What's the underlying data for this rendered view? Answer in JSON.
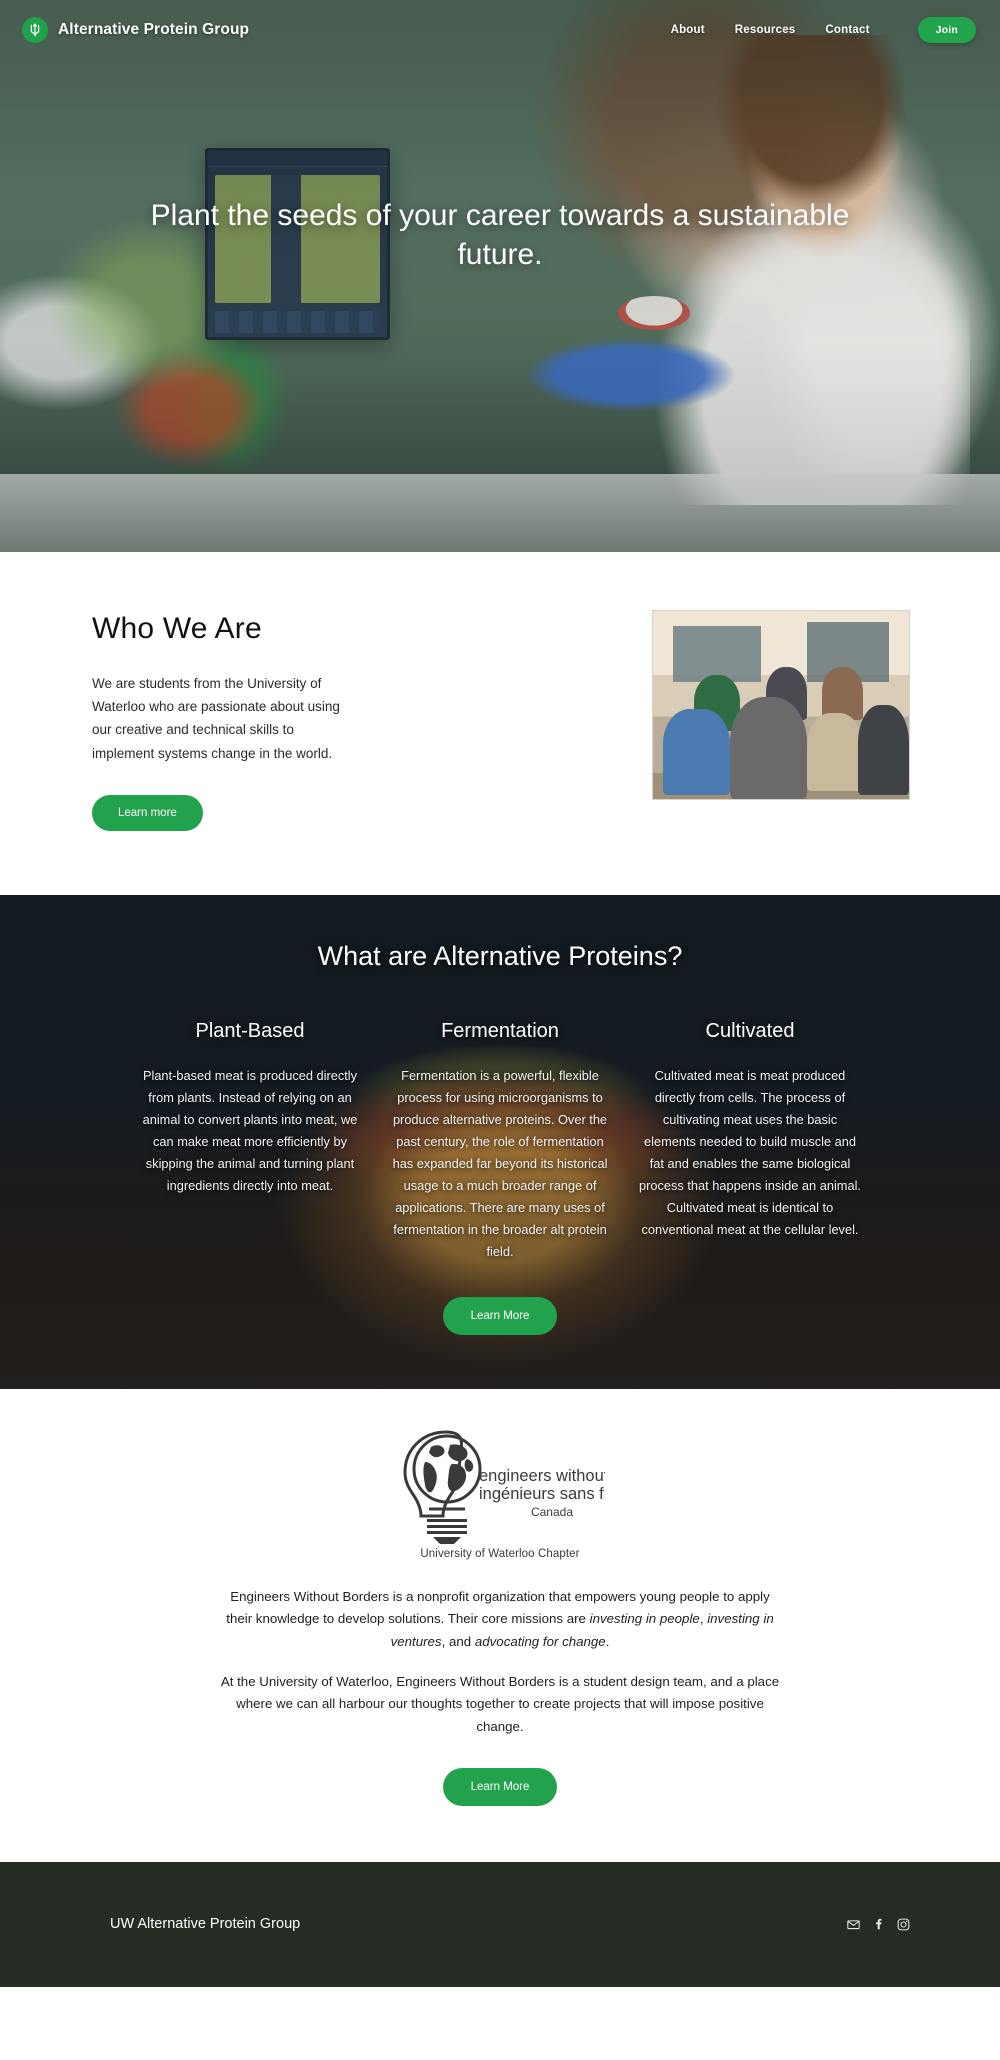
{
  "brand": {
    "name": "Alternative Protein Group",
    "logo_icon": "wheat-w-logo-icon",
    "accent_color": "#21a44c"
  },
  "nav": {
    "links": [
      {
        "label": "About"
      },
      {
        "label": "Resources"
      },
      {
        "label": "Contact"
      }
    ],
    "cta_label": "Join"
  },
  "hero": {
    "headline": "Plant the seeds of your career towards a sustainable future."
  },
  "who_we_are": {
    "title": "Who We Are",
    "body": "We are students from the University of Waterloo who are passionate about using our creative and technical skills to implement systems change in the world.",
    "button_label": "Learn more",
    "photo_alt": "students-meeting-photo"
  },
  "alt_proteins": {
    "title": "What are Alternative Proteins?",
    "columns": [
      {
        "heading": "Plant-Based",
        "body": "Plant-based meat is produced directly from plants. Instead of relying  on an animal to convert plants into meat, we can make meat more  efficiently by skipping the animal and turning plant ingredients directly into meat."
      },
      {
        "heading": "Fermentation",
        "body": "Fermentation is a powerful, flexible process for using microorganisms to produce alternative proteins. Over the past century, the role of fermentation has expanded far beyond its historical usage to a much broader range of applications. There are many uses of fermentation in the broader alt protein field."
      },
      {
        "heading": "Cultivated",
        "body": "Cultivated meat is meat produced directly from cells. The process of cultivating meat uses the basic elements needed to build muscle and fat and enables the same biological process that happens inside an animal. Cultivated meat is identical to conventional meat at the cellular level."
      }
    ],
    "button_label": "Learn More"
  },
  "ewb": {
    "logo_line1": "engineers without borders",
    "logo_line2": "ingénieurs sans frontières",
    "logo_line3": "Canada",
    "chapter": "University of Waterloo Chapter",
    "paragraph1_pre": "Engineers Without Borders is a nonprofit organization that empowers young people to apply their knowledge to develop solutions. Their core missions are ",
    "paragraph1_em1": "investing in people",
    "paragraph1_mid1": ", ",
    "paragraph1_em2": "investing in ventures",
    "paragraph1_mid2": ", and ",
    "paragraph1_em3": "advocating for change",
    "paragraph1_post": ".",
    "paragraph2": "At the University of Waterloo, Engineers Without Borders is a student design team, and a place where we can all harbour our thoughts together to create projects that will impose positive change.",
    "button_label": "Learn More"
  },
  "footer": {
    "title": "UW Alternative Protein Group",
    "social": [
      {
        "icon": "email-icon"
      },
      {
        "icon": "facebook-icon"
      },
      {
        "icon": "instagram-icon"
      }
    ]
  }
}
